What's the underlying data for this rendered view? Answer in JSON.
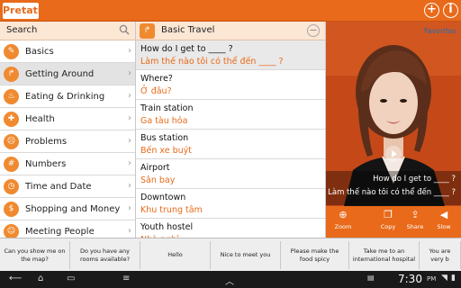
{
  "app": {
    "logo": "Pretati",
    "add_icon": "+",
    "info_icon": "i"
  },
  "sidebar": {
    "search_label": "Search",
    "items": [
      {
        "label": "Basics",
        "icon": "gear-icon",
        "glyph": "✎"
      },
      {
        "label": "Getting Around",
        "icon": "arrow-icon",
        "glyph": "↱",
        "selected": true
      },
      {
        "label": "Eating & Drinking",
        "icon": "fork-icon",
        "glyph": "♨"
      },
      {
        "label": "Health",
        "icon": "heart-icon",
        "glyph": "✚"
      },
      {
        "label": "Problems",
        "icon": "face-icon",
        "glyph": "☹"
      },
      {
        "label": "Numbers",
        "icon": "numbers-icon",
        "glyph": "#"
      },
      {
        "label": "Time and Date",
        "icon": "clock-icon",
        "glyph": "◷"
      },
      {
        "label": "Shopping and Money",
        "icon": "cart-icon",
        "glyph": "$"
      },
      {
        "label": "Meeting People",
        "icon": "people-icon",
        "glyph": "☺"
      }
    ]
  },
  "phrases": {
    "header": "Basic Travel",
    "items": [
      {
        "en": "How do I get to ____ ?",
        "vi": "Làm thế nào tôi có thể đến ____ ?",
        "selected": true
      },
      {
        "en": "Where?",
        "vi": "Ở đâu?"
      },
      {
        "en": "Train station",
        "vi": "Ga tàu hỏa"
      },
      {
        "en": "Bus station",
        "vi": "Bến xe buýt"
      },
      {
        "en": "Airport",
        "vi": "Sân bay"
      },
      {
        "en": "Downtown",
        "vi": "Khu trung tâm"
      },
      {
        "en": "Youth hostel",
        "vi": "Nhà nghỉ"
      }
    ]
  },
  "video": {
    "favorites": "Favorites",
    "caption_en": "How do I get to ____ ?",
    "caption_vi": "Làm thế nào tôi có thể đến ____ ?",
    "controls": [
      {
        "label": "Zoom",
        "glyph": "⊕",
        "icon": "zoom-icon"
      },
      {
        "label": "Copy",
        "glyph": "❐",
        "icon": "copy-icon"
      },
      {
        "label": "Share",
        "glyph": "⇪",
        "icon": "share-icon"
      },
      {
        "label": "Slow",
        "glyph": "◀",
        "icon": "speaker-icon"
      }
    ]
  },
  "quick_phrases": [
    "Can you show me on the map?",
    "Do you have any rooms available?",
    "Hello",
    "Nice to meet you",
    "Please make the food spicy",
    "Take me to an international hospital",
    "You are very b"
  ],
  "navbar": {
    "time": "7:30",
    "ampm": "PM"
  }
}
